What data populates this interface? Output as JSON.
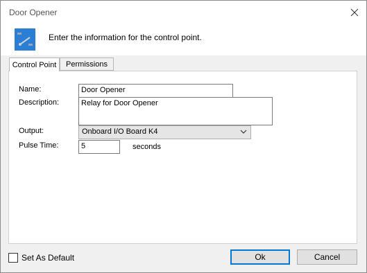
{
  "window": {
    "title": "Door Opener"
  },
  "header": {
    "text": "Enter the information for the control point."
  },
  "tabs": [
    {
      "label": "Control Point"
    },
    {
      "label": "Permissions"
    }
  ],
  "form": {
    "name_label": "Name:",
    "name_value": "Door Opener",
    "description_label": "Description:",
    "description_value": "Relay for Door Opener",
    "output_label": "Output:",
    "output_value": "Onboard I/O Board K4",
    "pulse_label": "Pulse Time:",
    "pulse_value": "5",
    "pulse_units": "seconds"
  },
  "footer": {
    "set_default_label": "Set As Default",
    "ok_label": "Ok",
    "cancel_label": "Cancel"
  },
  "colors": {
    "accent": "#0078d7",
    "icon_blue": "#2a7fd4"
  }
}
